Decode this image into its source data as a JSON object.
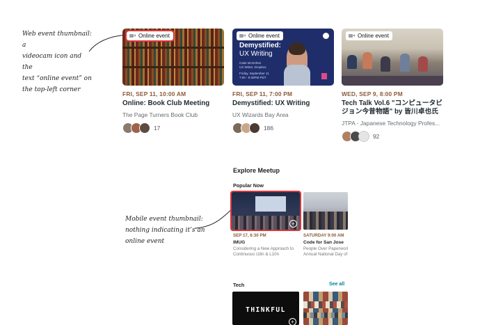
{
  "annotations": {
    "web_note": [
      "Web event thumbnail: a",
      "videocam icon and the",
      "text “online event” on",
      "the top-left corner"
    ],
    "mobile_note": [
      "Mobile event thumbnail:",
      "nothing indicating it’s an",
      "online event"
    ]
  },
  "events": [
    {
      "badge": "Online event",
      "date": "FRI, SEP 11, 10:00 AM",
      "title": "Online: Book Club Meeting",
      "group": "The Page Turners Book Club",
      "attendees": "17"
    },
    {
      "badge": "Online event",
      "date": "FRI, SEP 11, 7:00 PM",
      "title": "Demystified: UX Writing",
      "group": "UX Wizards Bay Area",
      "attendees": "186",
      "thumb": {
        "heading": "Demystified:",
        "subheading": "UX Writing",
        "speaker": "Catie McGehee",
        "speaker_role": "UX Writer, Dropbox",
        "when": "Friday, September 11",
        "time": "7:00 - 8:30PM PDT"
      }
    },
    {
      "badge": "Online event",
      "date": "WED, SEP 9, 8:00 PM",
      "title": "Tech Talk Vol.6 \"コンピュータビジョン今昔物語\" by 皆川卓也氏",
      "group": "JTPA - Japanese Technology Profes...",
      "attendees": "92"
    }
  ],
  "mobile": {
    "heading": "Explore Meetup",
    "popular_label": "Popular Now",
    "items": [
      {
        "date": "SEP 17, 6:30 PM",
        "title": "IMUG",
        "desc": [
          "Considering a New Approach to",
          "Continuous i18n & L10n"
        ]
      },
      {
        "date": "SATURDAY 9:00 AM",
        "title": "Code for San Jose",
        "desc": [
          "People Over Paperwork",
          "Annual National Day of"
        ]
      }
    ],
    "tech_label": "Tech",
    "see_all": "See all",
    "tech_brand": "THINKFUL",
    "plus_symbol": "+"
  },
  "colors": {
    "accent_red": "#d9373b",
    "date_brown": "#8a5a3a",
    "link_teal": "#00829b"
  }
}
